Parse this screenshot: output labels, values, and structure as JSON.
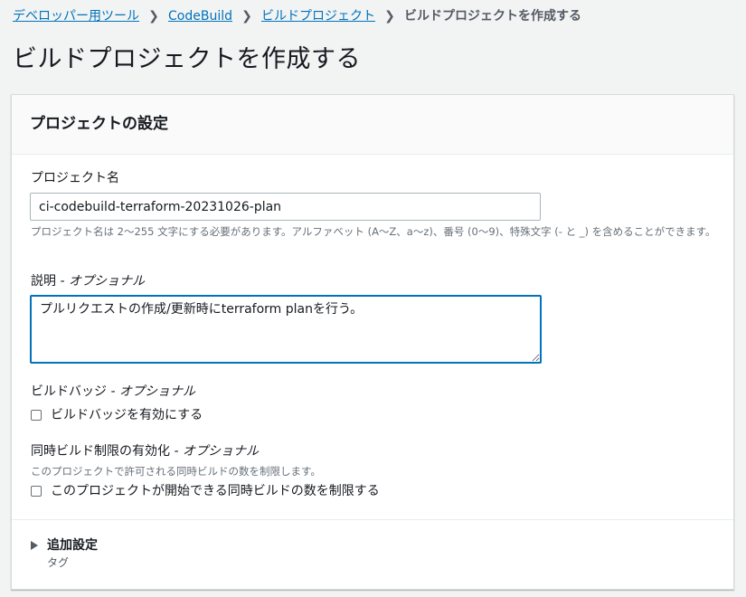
{
  "breadcrumb": {
    "items": [
      "デベロッパー用ツール",
      "CodeBuild",
      "ビルドプロジェクト"
    ],
    "current": "ビルドプロジェクトを作成する"
  },
  "page": {
    "title": "ビルドプロジェクトを作成する"
  },
  "panel": {
    "title": "プロジェクトの設定",
    "project_name": {
      "label": "プロジェクト名",
      "value": "ci-codebuild-terraform-20231026-plan",
      "constraint": "プロジェクト名は 2〜255 文字にする必要があります。アルファベット (A〜Z、a〜z)、番号 (0〜9)、特殊文字 (- と _) を含めることができます。"
    },
    "description": {
      "label": "説明",
      "optional": "- オプショナル",
      "value": "プルリクエストの作成/更新時にterraform planを行う。"
    },
    "build_badge": {
      "label": "ビルドバッジ",
      "optional": "- オプショナル",
      "checkbox_label": "ビルドバッジを有効にする",
      "checked": false
    },
    "concurrent": {
      "label": "同時ビルド制限の有効化",
      "optional": "- オプショナル",
      "description": "このプロジェクトで許可される同時ビルドの数を制限します。",
      "checkbox_label": "このプロジェクトが開始できる同時ビルドの数を制限する",
      "checked": false
    },
    "additional": {
      "label": "追加設定",
      "sub": "タグ"
    }
  },
  "colors": {
    "link": "#0073bb",
    "focus_border": "#0073bb",
    "background": "#f2f3f3"
  }
}
